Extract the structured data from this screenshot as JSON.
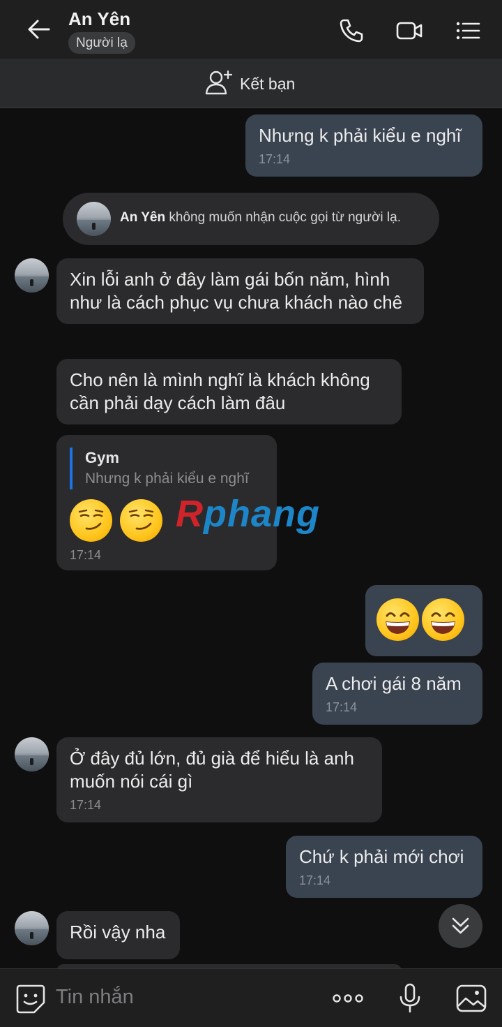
{
  "header": {
    "title": "An Yên",
    "badge": "Người lạ",
    "icons": [
      "back-arrow-icon",
      "phone-icon",
      "video-icon",
      "menu-list-icon"
    ]
  },
  "friend_bar": {
    "label": "Kết bạn",
    "icon": "add-user-icon"
  },
  "messages": [
    {
      "side": "out",
      "text": "Nhưng k phải kiểu e nghĩ",
      "time": "17:14"
    },
    {
      "side": "system",
      "name": "An Yên",
      "text": " không muốn nhận cuộc gọi từ người lạ."
    },
    {
      "side": "in",
      "text": "Xin lỗi anh ở đây làm gái bốn năm, hình như là cách phục vụ chưa khách nào chê"
    },
    {
      "side": "in",
      "text": "Cho nên là mình nghĩ là khách không cần phải dạy cách làm đâu"
    },
    {
      "side": "in",
      "quote_name": "Gym",
      "quote_text": "Nhưng k phải kiểu e nghĩ",
      "emoji": "smirk-emoji",
      "time": "17:14"
    },
    {
      "side": "out",
      "emoji": "grin-emoji"
    },
    {
      "side": "out",
      "text": "A chơi gái 8 năm",
      "time": "17:14"
    },
    {
      "side": "in",
      "text": "Ở đây đủ lớn, đủ già để hiểu là anh muốn nói cái gì",
      "time": "17:14"
    },
    {
      "side": "out",
      "text": "Chứ k phải mới chơi",
      "time": "17:14"
    },
    {
      "side": "in",
      "text": "Rồi vậy nha"
    }
  ],
  "watermark": {
    "part1": "R",
    "part2": "phang"
  },
  "composer": {
    "placeholder": "Tin nhắn"
  },
  "colors": {
    "incoming_bubble": "#2b2b2d",
    "outgoing_bubble": "#3a4350",
    "quote_bar": "#1a73e8",
    "background": "#0f0f10"
  }
}
